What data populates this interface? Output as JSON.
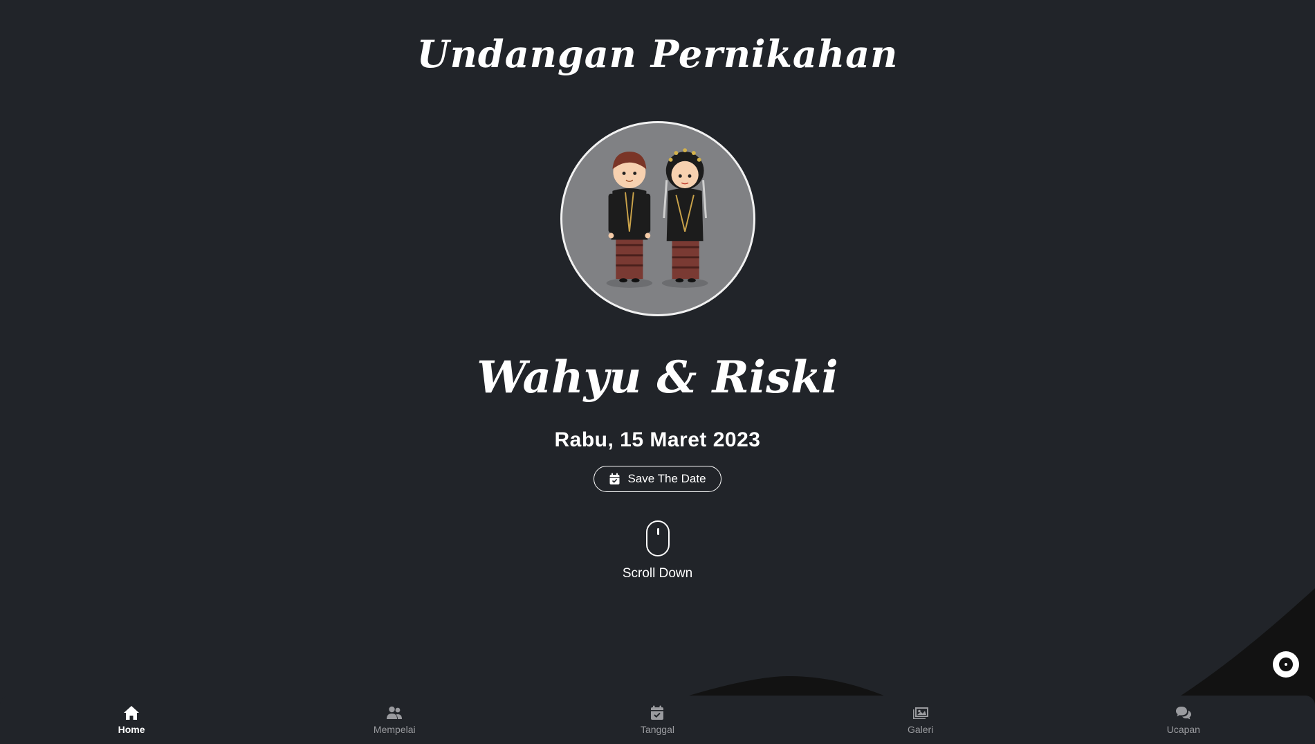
{
  "header": {
    "title": "Undangan Pernikahan"
  },
  "hero": {
    "couple_names": "Wahyu & Riski",
    "date": "Rabu, 15 Maret 2023",
    "save_date_label": "Save The Date",
    "scroll_label": "Scroll Down"
  },
  "nav": {
    "items": [
      {
        "label": "Home",
        "icon": "home-icon",
        "active": true
      },
      {
        "label": "Mempelai",
        "icon": "users-icon",
        "active": false
      },
      {
        "label": "Tanggal",
        "icon": "calendar-check-icon",
        "active": false
      },
      {
        "label": "Galeri",
        "icon": "images-icon",
        "active": false
      },
      {
        "label": "Ucapan",
        "icon": "comments-icon",
        "active": false
      }
    ]
  },
  "music_button": {
    "icon": "music-disc-icon"
  },
  "colors": {
    "background": "#212429",
    "wave": "#121212",
    "text": "#ffffff",
    "nav_inactive": "#9a9b9f",
    "portrait_bg": "#808184"
  }
}
